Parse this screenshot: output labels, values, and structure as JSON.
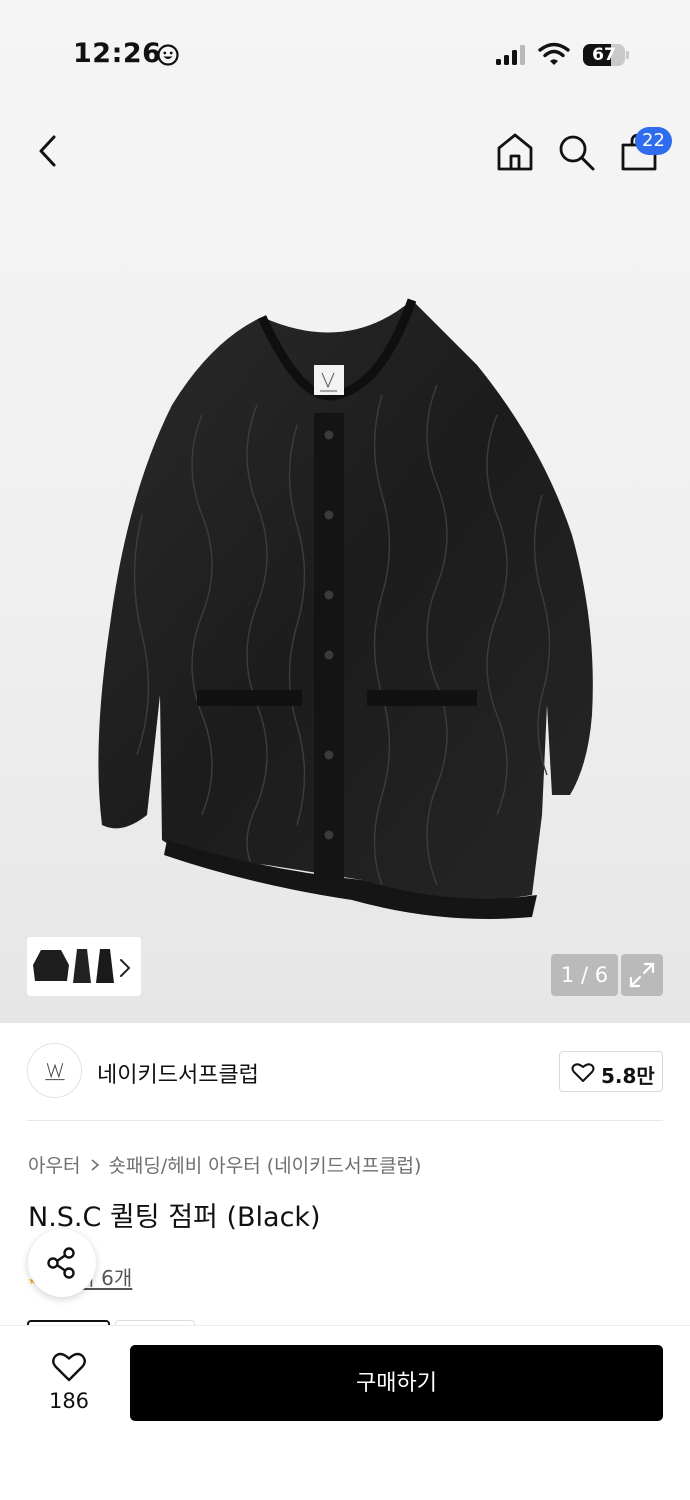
{
  "status_bar": {
    "time": "12:26",
    "battery": "67",
    "battery_level": 0.67
  },
  "nav": {
    "cart_count": "22"
  },
  "gallery": {
    "counter": "1 / 6"
  },
  "brand": {
    "name": "네이키드서프클럽",
    "likes": "5.8만"
  },
  "product": {
    "breadcrumb": [
      "아우터",
      "숏패딩/헤비 아우터 (네이키드서프클럽)"
    ],
    "title": "N.S.C 퀼팅 점퍼 (Black)",
    "review_text": "후기 6개"
  },
  "bottom_bar": {
    "wish_count": "186",
    "buy_label": "구매하기"
  },
  "colors": {
    "accent": "#2f6cf0",
    "buy_button": "#000000",
    "rating_star": "#f5a623"
  }
}
